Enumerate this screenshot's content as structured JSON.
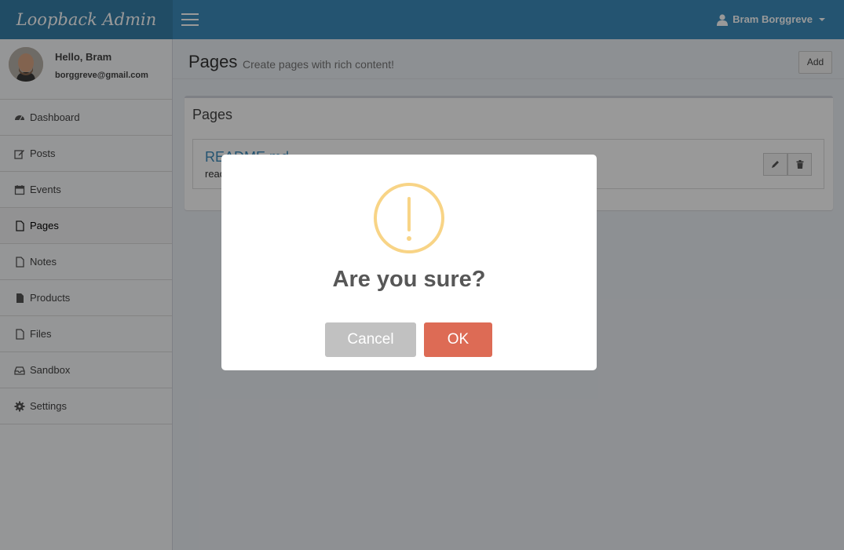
{
  "header": {
    "logo": "Loopback Admin",
    "user_name": "Bram Borggreve"
  },
  "sidebar": {
    "hello": "Hello, Bram",
    "email": "borggreve@gmail.com",
    "items": [
      {
        "label": "Dashboard",
        "icon": "dashboard-icon"
      },
      {
        "label": "Posts",
        "icon": "edit-icon"
      },
      {
        "label": "Events",
        "icon": "calendar-icon"
      },
      {
        "label": "Pages",
        "icon": "file-icon",
        "active": true
      },
      {
        "label": "Notes",
        "icon": "file-icon"
      },
      {
        "label": "Products",
        "icon": "file-filled-icon"
      },
      {
        "label": "Files",
        "icon": "file-icon"
      },
      {
        "label": "Sandbox",
        "icon": "inbox-icon"
      },
      {
        "label": "Settings",
        "icon": "gear-icon"
      }
    ]
  },
  "content": {
    "title": "Pages",
    "subtitle": "Create pages with rich content!",
    "add_label": "Add",
    "box_title": "Pages",
    "row": {
      "name": "README.md",
      "description": "readme"
    }
  },
  "modal": {
    "title": "Are you sure?",
    "cancel_label": "Cancel",
    "ok_label": "OK",
    "icon": "warning-icon"
  },
  "colors": {
    "header": "#3c8dbc",
    "logo_bg": "#367fa9",
    "ok": "#dd6b55",
    "cancel": "#c1c1c1",
    "warning": "#f8d486"
  }
}
